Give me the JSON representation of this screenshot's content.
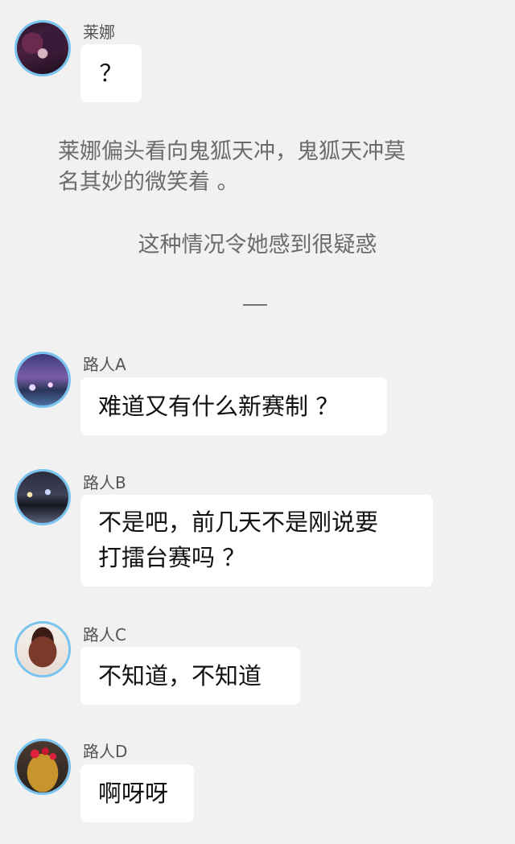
{
  "messages": [
    {
      "sender": "莱娜",
      "avatar_icon": "avatar-lena-icon",
      "text_lines": [
        "？"
      ]
    },
    {
      "sender": "路人A",
      "avatar_icon": "avatar-city-night-icon",
      "text_lines": [
        "难道又有什么新赛制 ？"
      ]
    },
    {
      "sender": "路人B",
      "avatar_icon": "avatar-river-night-icon",
      "text_lines": [
        "不是吧，前几天不是刚说要",
        "打擂台赛吗 ？"
      ]
    },
    {
      "sender": "路人C",
      "avatar_icon": "avatar-cake-icon",
      "text_lines": [
        "不知道，不知道"
      ]
    },
    {
      "sender": "路人D",
      "avatar_icon": "avatar-dessert-icon",
      "text_lines": [
        "啊呀呀"
      ]
    }
  ],
  "narration": {
    "line1": "莱娜偏头看向鬼狐天冲，鬼狐天冲莫",
    "line2": "名其妙的微笑着 。",
    "line3": "这种情况令她感到很疑惑"
  },
  "colors": {
    "background": "#f1f1f1",
    "bubble": "#ffffff",
    "avatar_ring": "#79c3ef",
    "narration_text": "#6b6b6b"
  }
}
